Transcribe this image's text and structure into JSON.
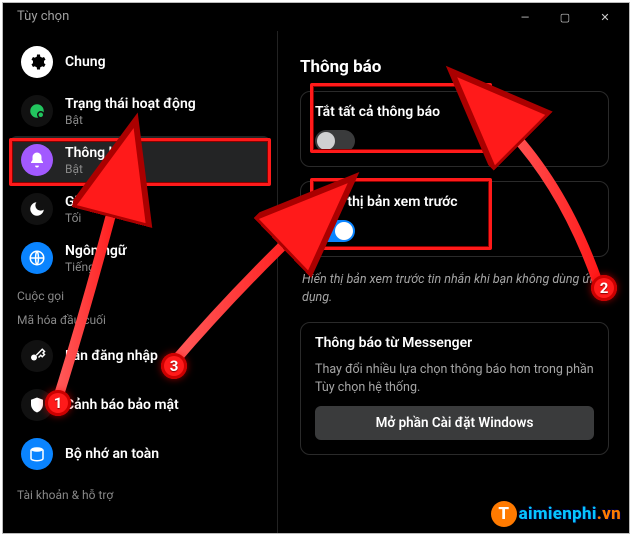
{
  "window": {
    "title": "Tùy chọn",
    "controls": {
      "minimize": "—",
      "maximize": "▢",
      "close": "✕"
    }
  },
  "sidebar": {
    "sections": [
      {
        "label": "",
        "items": [
          {
            "title": "Chung",
            "sub": "",
            "icon": "gear-icon",
            "bg": "#ffffff",
            "fg": "#000"
          },
          {
            "title": "Trạng thái hoạt động",
            "sub": "Bật",
            "icon": "status-icon",
            "bg": "#111",
            "fg": "#2ecc71"
          },
          {
            "title": "Thông báo",
            "sub": "Bật",
            "icon": "bell-icon",
            "bg": "#a259ff",
            "fg": "#fff",
            "selected": true
          },
          {
            "title": "Giao diện",
            "sub": "Tối",
            "icon": "moon-icon",
            "bg": "#111",
            "fg": "#fff"
          },
          {
            "title": "Ngôn ngữ",
            "sub": "Tiếng",
            "icon": "globe-icon",
            "bg": "#0a84ff",
            "fg": "#fff"
          }
        ]
      },
      {
        "label": "Cuộc gọi",
        "items": []
      },
      {
        "label": "Mã hóa đầu cuối",
        "items": [
          {
            "title": "Lần đăng nhập",
            "sub": "",
            "icon": "key-icon",
            "bg": "#111",
            "fg": "#fff"
          },
          {
            "title": "Cảnh báo bảo mật",
            "sub": "",
            "icon": "shield-icon",
            "bg": "#111",
            "fg": "#fff"
          },
          {
            "title": "Bộ nhớ an toàn",
            "sub": "",
            "icon": "storage-icon",
            "bg": "#0a84ff",
            "fg": "#fff"
          }
        ]
      },
      {
        "label": "Tài khoản & hỗ trợ",
        "items": []
      }
    ]
  },
  "main": {
    "title": "Thông báo",
    "toggle_all": {
      "label": "Tắt tất cả thông báo",
      "on": false
    },
    "preview": {
      "label": "Hiển thị bản xem trước",
      "on": true
    },
    "preview_hint": "Hiển thị bản xem trước tin nhắn khi bạn không dùng ứng dụng.",
    "messenger": {
      "title": "Thông báo từ Messenger",
      "desc": "Thay đổi nhiều lựa chọn thông báo hơn trong phần Tùy chọn hệ thống.",
      "button": "Mở phần Cài đặt Windows"
    }
  },
  "annotations": {
    "badges": {
      "b1": "1",
      "b2": "2",
      "b3": "3"
    }
  },
  "watermark": {
    "t": "T",
    "text": "aimienphi",
    "tld": ".vn"
  }
}
